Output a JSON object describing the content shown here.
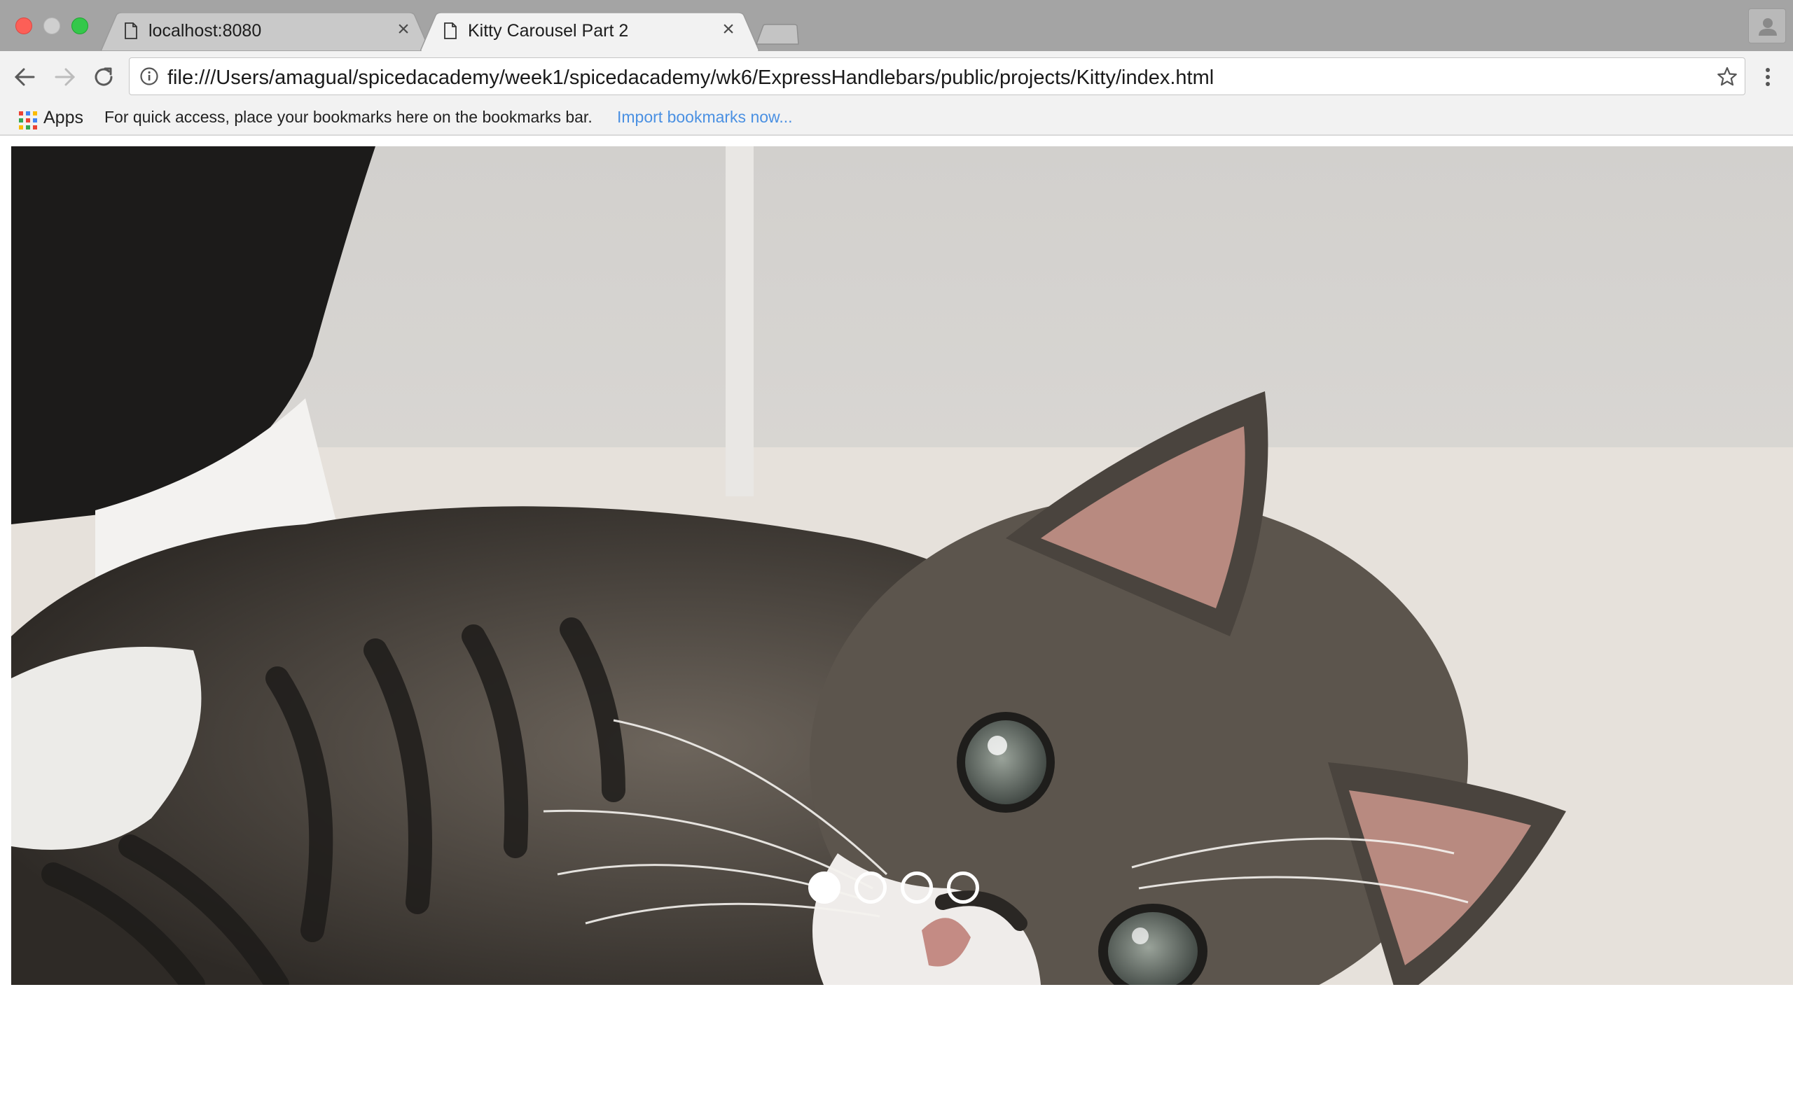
{
  "browser": {
    "tabs": [
      {
        "title": "localhost:8080",
        "active": false
      },
      {
        "title": "Kitty Carousel Part 2",
        "active": true
      }
    ],
    "address_bar": {
      "url": "file:///Users/amagual/spicedacademy/week1/spicedacademy/wk6/ExpressHandlebars/public/projects/Kitty/index.html"
    },
    "bookmarks_bar": {
      "apps_label": "Apps",
      "hint": "For quick access, place your bookmarks here on the bookmarks bar.",
      "import_link": "Import bookmarks now..."
    }
  },
  "page": {
    "carousel": {
      "current_slide": 1,
      "slide_count": 4,
      "image": "tabby-kitten-photo"
    }
  },
  "colors": {
    "titlebar": "#a4a4a4",
    "toolbar": "#f2f2f2",
    "link": "#4a90e2",
    "dot": "#ffffff"
  }
}
